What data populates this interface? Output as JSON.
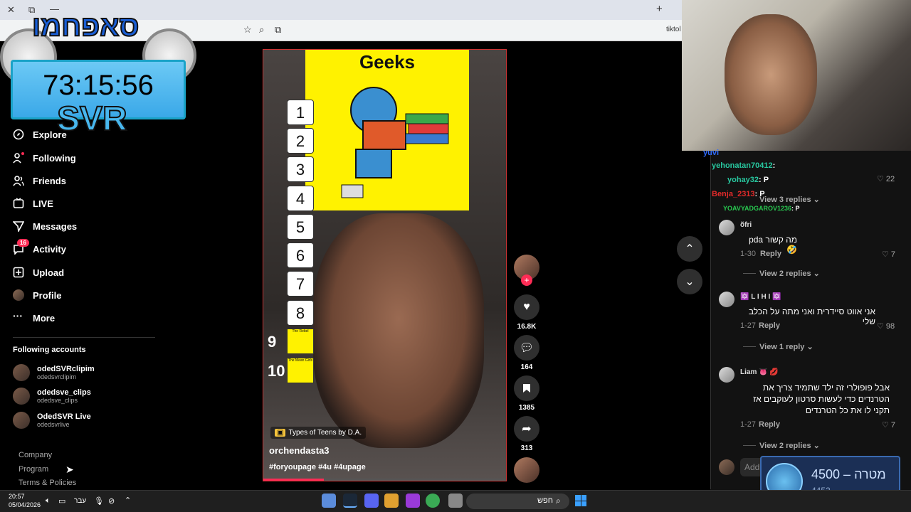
{
  "browser": {
    "address_suffix": "tiktol",
    "close_glyph": "✕",
    "newtab_glyph": "+",
    "minimize_glyph": "—",
    "maximize_glyph": "⧉"
  },
  "overlay": {
    "logo_text": "סאפחמו",
    "timer": "73:15:56",
    "svr": "SVR"
  },
  "nav": {
    "items": [
      {
        "label": "Explore",
        "icon": "compass-icon"
      },
      {
        "label": "Following",
        "icon": "user-follow-icon"
      },
      {
        "label": "Friends",
        "icon": "friends-icon"
      },
      {
        "label": "LIVE",
        "icon": "live-icon"
      },
      {
        "label": "Messages",
        "icon": "send-icon"
      },
      {
        "label": "Activity",
        "icon": "activity-icon",
        "badge": "16"
      },
      {
        "label": "Upload",
        "icon": "upload-icon"
      },
      {
        "label": "Profile",
        "icon": "avatar"
      },
      {
        "label": "More",
        "icon": "more-icon"
      }
    ],
    "following_title": "Following accounts",
    "accounts": [
      {
        "name": "odedSVRclipim",
        "handle": "odedsvrclipim"
      },
      {
        "name": "odedsve_clips",
        "handle": "odedsve_clips"
      },
      {
        "name": "OdedSVR Live",
        "handle": "odedsvrlive"
      }
    ],
    "footer": [
      "Company",
      "Program",
      "Terms & Policies"
    ]
  },
  "video": {
    "title": "Geeks",
    "ranks": [
      "1",
      "2",
      "3",
      "4",
      "5",
      "6",
      "7",
      "8"
    ],
    "ranks_outside": [
      "9",
      "10"
    ],
    "thumb_labels": [
      "The Rebel",
      "The Mean Girls"
    ],
    "tag": "Types of Teens by D.A.",
    "username": "orchendasta3",
    "hashtags": "#foryoupage #4u #4upage",
    "progress_fraction": 0.25
  },
  "actions": {
    "likes": "16.8K",
    "comments": "164",
    "saves": "1385",
    "shares": "313"
  },
  "chat": [
    {
      "user": "yuvi",
      "text": "",
      "color": "#2f6bff"
    },
    {
      "user": "yehonatan70412",
      "text": ": ",
      "color": "#28c8a0"
    },
    {
      "user": "yohay32",
      "text": ": P",
      "color": "#28c8a0"
    },
    {
      "user": "Benja_2313",
      "text": ": P",
      "color": "#e02a2a"
    },
    {
      "user": "YOAVYADGAROV1236",
      "text": ": P",
      "color": "#28c850"
    }
  ],
  "comments": {
    "top_like": "22",
    "top_view": "View 3 replies",
    "items": [
      {
        "name": "õfri",
        "text": "מה קשור pda🤣",
        "date": "1-30",
        "reply": "Reply",
        "likes": "7",
        "view": "View 2 replies"
      },
      {
        "name": "🔯 L I H I 🔯",
        "text": "אני אווט סיידרית ואני מתה על הכלב שלי",
        "date": "1-27",
        "reply": "Reply",
        "likes": "98",
        "view": "View 1 reply"
      },
      {
        "name": "Liam 👅 💋",
        "text": "אבל פופולרי זה ילד שתמיד צריך את הטרנדים כדי לעשות סרטון לעוקבים אז תקני לו את כל הטרנדים",
        "date": "1-27",
        "reply": "Reply",
        "likes": "7",
        "view": "View 2 replies"
      }
    ],
    "add_placeholder": "Add"
  },
  "goal": {
    "label": "4500 – מטרה",
    "current": "4452"
  },
  "taskbar": {
    "time": "20:57",
    "date": "05/04/2026",
    "lang": "עבר",
    "search": "חפש"
  }
}
